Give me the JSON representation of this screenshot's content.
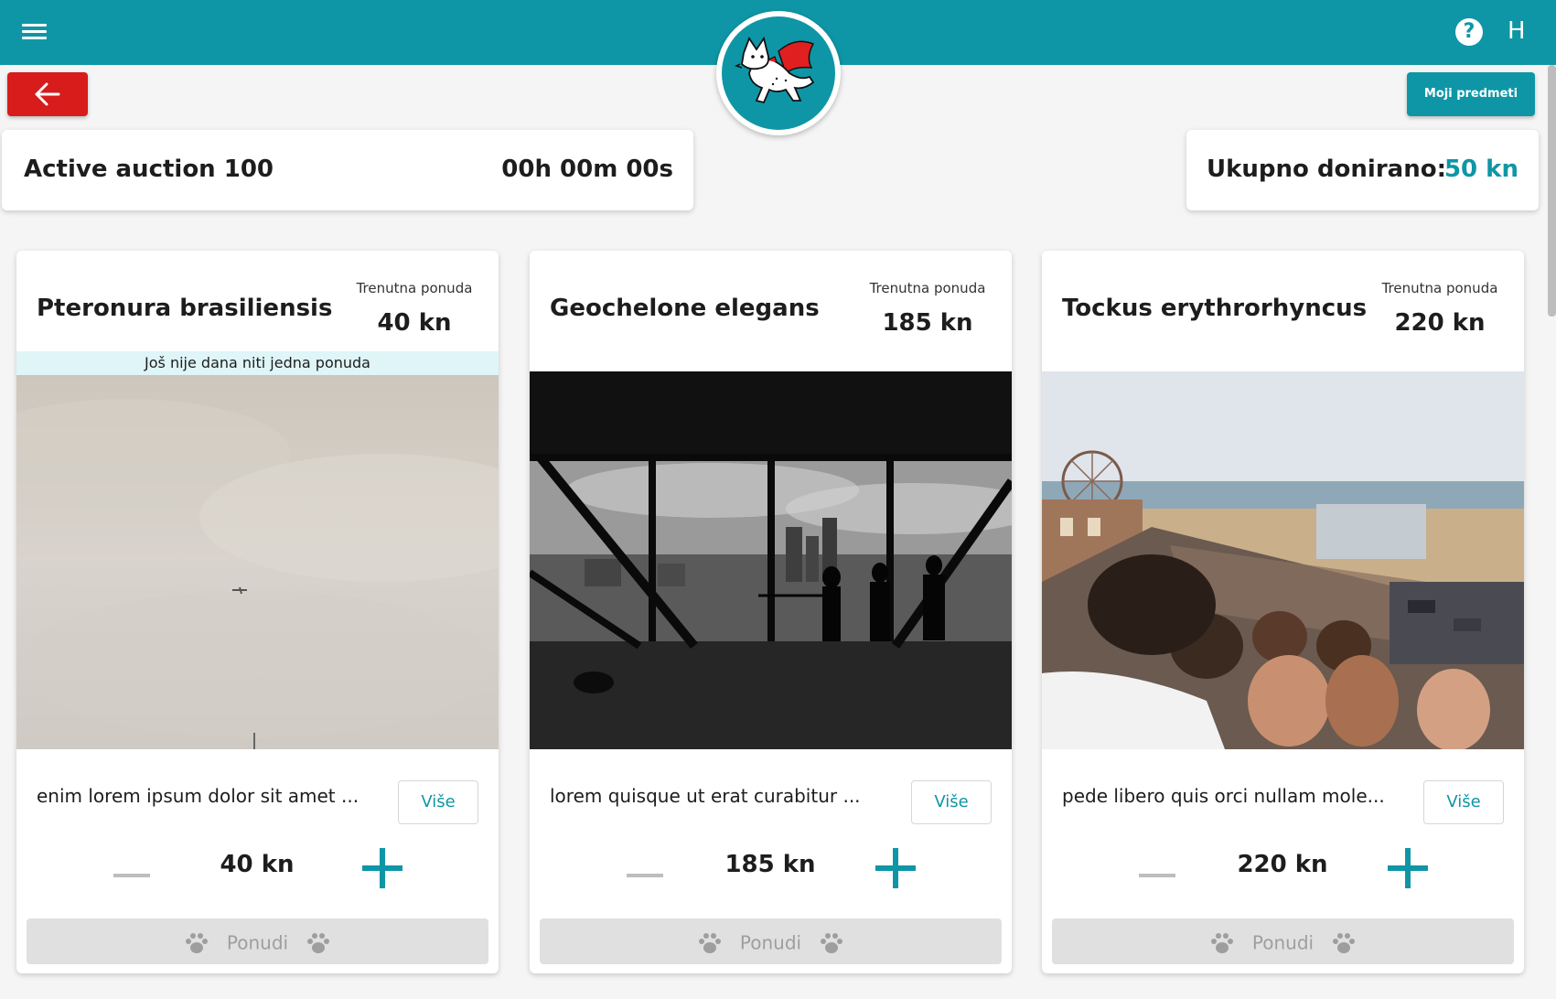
{
  "header": {
    "user_initial": "H",
    "help_symbol": "?",
    "icons": [
      "menu-icon",
      "help-icon",
      "back-arrow-icon",
      "paw-icon",
      "plus-icon",
      "minus-icon"
    ],
    "colors": {
      "primary": "#0f96a6",
      "danger": "#d81b1b",
      "disabled": "#e0e0e0"
    }
  },
  "toolbar": {
    "my_items_label": "Moji predmeti"
  },
  "auction": {
    "title": "Active auction 100",
    "timer": "00h 00m 00s"
  },
  "donations": {
    "label": "Ukupno donirano:",
    "value": "50 kn"
  },
  "items": [
    {
      "name": "Pteronura brasiliensis",
      "bid_caption": "Trenutna ponuda",
      "current_bid": "40 kn",
      "no_bids_notice": "Još nije dana niti jedna ponuda",
      "description": "enim lorem ipsum dolor sit amet ...",
      "more_label": "Više",
      "bid_amount": "40 kn",
      "offer_label": "Ponudi"
    },
    {
      "name": "Geochelone elegans",
      "bid_caption": "Trenutna ponuda",
      "current_bid": "185 kn",
      "description": "lorem quisque ut erat curabitur ...",
      "more_label": "Više",
      "bid_amount": "185 kn",
      "offer_label": "Ponudi"
    },
    {
      "name": "Tockus erythrorhyncus",
      "bid_caption": "Trenutna ponuda",
      "current_bid": "220 kn",
      "description": "pede libero quis orci nullam mole...",
      "more_label": "Više",
      "bid_amount": "220 kn",
      "offer_label": "Ponudi"
    }
  ]
}
